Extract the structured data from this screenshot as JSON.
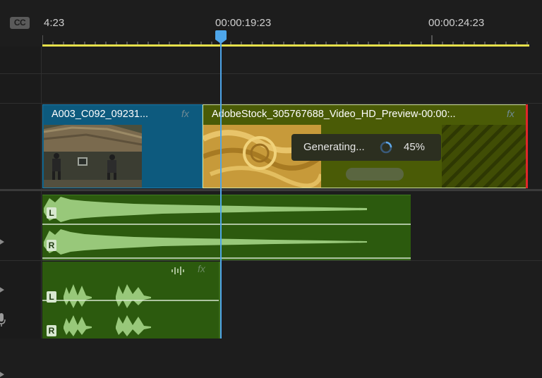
{
  "ruler": {
    "cc_label": "CC",
    "timecodes": [
      "4:23",
      "00:00:19:23",
      "00:00:24:23"
    ]
  },
  "clips": {
    "v1_title": "A003_C092_09231...",
    "v2_title": "AdobeStock_305767688_Video_HD_Preview-00:00:..",
    "fx_label": "fx"
  },
  "generating": {
    "label": "Generating...",
    "percent_text": "45%",
    "progress": 0.45
  },
  "audio": {
    "left_label": "L",
    "right_label": "R"
  },
  "colors": {
    "playhead": "#4ea6ea",
    "work_area": "#e6e04a",
    "video_clip": "#0d5a7e",
    "generative_clip": "#4a5b06",
    "audio_clip": "#2c5a0e",
    "out_point": "#e0262a"
  }
}
